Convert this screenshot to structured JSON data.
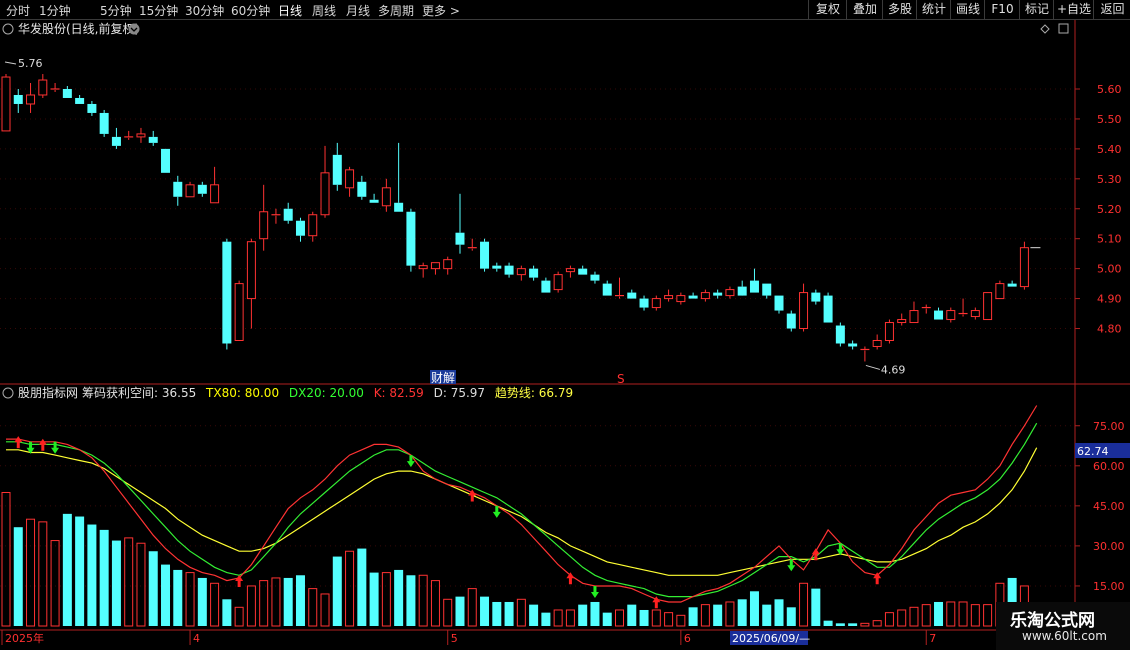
{
  "toolbar": {
    "periods": [
      {
        "label": "分时",
        "active": false
      },
      {
        "label": "1分钟",
        "active": false
      },
      {
        "label": "5分钟",
        "active": false
      },
      {
        "label": "15分钟",
        "active": false
      },
      {
        "label": "30分钟",
        "active": false
      },
      {
        "label": "60分钟",
        "active": false
      },
      {
        "label": "日线",
        "active": true
      },
      {
        "label": "周线",
        "active": false
      },
      {
        "label": "月线",
        "active": false
      },
      {
        "label": "多周期",
        "active": false
      },
      {
        "label": "更多 >",
        "active": false
      }
    ],
    "buttons": [
      "复权",
      "叠加",
      "多股",
      "统计",
      "画线",
      "F10",
      "标记",
      "+自选",
      "返回"
    ]
  },
  "main_panel": {
    "title": "华发股份(日线,前复权)",
    "high_label": "5.76",
    "low_label": "4.69",
    "event_markers": [
      "财解",
      "S"
    ],
    "yaxis_ticks": [
      "5.60",
      "5.50",
      "5.40",
      "5.30",
      "5.20",
      "5.10",
      "5.00",
      "4.90",
      "4.80"
    ]
  },
  "indicator_panel": {
    "name": "股朋指标网",
    "legend": [
      {
        "text": "筹码获利空间: 36.55",
        "color": "#e0e0e0"
      },
      {
        "text": "TX80: 80.00",
        "color": "#ffff00"
      },
      {
        "text": "DX20: 20.00",
        "color": "#33ff33"
      },
      {
        "text": "K: 82.59",
        "color": "#ff3333"
      },
      {
        "text": "D: 75.97",
        "color": "#dddddd"
      },
      {
        "text": "趋势线: 66.79",
        "color": "#ffff44"
      }
    ],
    "yaxis_ticks": [
      "75.00",
      "60.00",
      "45.00",
      "30.00",
      "15.00"
    ],
    "current_value": "62.74"
  },
  "date_axis": {
    "labels": [
      "2025年",
      "4",
      "5",
      "6",
      "7"
    ],
    "cursor_date": "2025/06/09/—"
  },
  "watermark": {
    "name": "乐淘公式网",
    "url": "www.60lt.com"
  },
  "colors": {
    "up": "#ff3232",
    "down": "#54ffff",
    "k_line": "#ff3333",
    "d_line": "#33ee33",
    "trend": "#ffff33",
    "axis": "#ff2020"
  },
  "chart_data": {
    "type": "candlestick",
    "x_axis_labels": [
      "2025年",
      "4",
      "5",
      "6",
      "7"
    ],
    "candles": [
      {
        "o": 5.46,
        "h": 5.65,
        "l": 5.46,
        "c": 5.64
      },
      {
        "o": 5.58,
        "h": 5.6,
        "l": 5.52,
        "c": 5.55
      },
      {
        "o": 5.55,
        "h": 5.62,
        "l": 5.52,
        "c": 5.58
      },
      {
        "o": 5.58,
        "h": 5.65,
        "l": 5.57,
        "c": 5.63
      },
      {
        "o": 5.6,
        "h": 5.62,
        "l": 5.59,
        "c": 5.6
      },
      {
        "o": 5.6,
        "h": 5.61,
        "l": 5.57,
        "c": 5.57
      },
      {
        "o": 5.57,
        "h": 5.58,
        "l": 5.55,
        "c": 5.55
      },
      {
        "o": 5.55,
        "h": 5.56,
        "l": 5.51,
        "c": 5.52
      },
      {
        "o": 5.52,
        "h": 5.53,
        "l": 5.44,
        "c": 5.45
      },
      {
        "o": 5.44,
        "h": 5.47,
        "l": 5.4,
        "c": 5.41
      },
      {
        "o": 5.44,
        "h": 5.46,
        "l": 5.43,
        "c": 5.44
      },
      {
        "o": 5.44,
        "h": 5.47,
        "l": 5.42,
        "c": 5.45
      },
      {
        "o": 5.44,
        "h": 5.46,
        "l": 5.41,
        "c": 5.42
      },
      {
        "o": 5.4,
        "h": 5.4,
        "l": 5.32,
        "c": 5.32
      },
      {
        "o": 5.29,
        "h": 5.31,
        "l": 5.21,
        "c": 5.24
      },
      {
        "o": 5.24,
        "h": 5.29,
        "l": 5.24,
        "c": 5.28
      },
      {
        "o": 5.28,
        "h": 5.29,
        "l": 5.24,
        "c": 5.25
      },
      {
        "o": 5.22,
        "h": 5.34,
        "l": 5.22,
        "c": 5.28
      },
      {
        "o": 5.09,
        "h": 5.1,
        "l": 4.73,
        "c": 4.75
      },
      {
        "o": 4.76,
        "h": 4.96,
        "l": 4.76,
        "c": 4.95
      },
      {
        "o": 4.9,
        "h": 5.1,
        "l": 4.8,
        "c": 5.09
      },
      {
        "o": 5.1,
        "h": 5.28,
        "l": 5.06,
        "c": 5.19
      },
      {
        "o": 5.18,
        "h": 5.2,
        "l": 5.15,
        "c": 5.18
      },
      {
        "o": 5.2,
        "h": 5.22,
        "l": 5.15,
        "c": 5.16
      },
      {
        "o": 5.16,
        "h": 5.17,
        "l": 5.09,
        "c": 5.11
      },
      {
        "o": 5.11,
        "h": 5.19,
        "l": 5.09,
        "c": 5.18
      },
      {
        "o": 5.18,
        "h": 5.41,
        "l": 5.17,
        "c": 5.32
      },
      {
        "o": 5.38,
        "h": 5.42,
        "l": 5.26,
        "c": 5.28
      },
      {
        "o": 5.27,
        "h": 5.34,
        "l": 5.24,
        "c": 5.33
      },
      {
        "o": 5.29,
        "h": 5.31,
        "l": 5.23,
        "c": 5.24
      },
      {
        "o": 5.23,
        "h": 5.25,
        "l": 5.22,
        "c": 5.22
      },
      {
        "o": 5.21,
        "h": 5.3,
        "l": 5.19,
        "c": 5.27
      },
      {
        "o": 5.22,
        "h": 5.42,
        "l": 5.19,
        "c": 5.19
      },
      {
        "o": 5.19,
        "h": 5.2,
        "l": 4.99,
        "c": 5.01
      },
      {
        "o": 5.0,
        "h": 5.02,
        "l": 4.97,
        "c": 5.01
      },
      {
        "o": 5.0,
        "h": 5.02,
        "l": 4.98,
        "c": 5.02
      },
      {
        "o": 5.0,
        "h": 5.04,
        "l": 4.98,
        "c": 5.03
      },
      {
        "o": 5.12,
        "h": 5.25,
        "l": 5.05,
        "c": 5.08
      },
      {
        "o": 5.07,
        "h": 5.1,
        "l": 5.06,
        "c": 5.07
      },
      {
        "o": 5.09,
        "h": 5.1,
        "l": 4.99,
        "c": 5.0
      },
      {
        "o": 5.01,
        "h": 5.02,
        "l": 4.99,
        "c": 5.0
      },
      {
        "o": 5.01,
        "h": 5.02,
        "l": 4.97,
        "c": 4.98
      },
      {
        "o": 4.98,
        "h": 5.01,
        "l": 4.96,
        "c": 5.0
      },
      {
        "o": 5.0,
        "h": 5.01,
        "l": 4.96,
        "c": 4.97
      },
      {
        "o": 4.96,
        "h": 4.97,
        "l": 4.92,
        "c": 4.92
      },
      {
        "o": 4.93,
        "h": 4.99,
        "l": 4.92,
        "c": 4.98
      },
      {
        "o": 4.99,
        "h": 5.01,
        "l": 4.97,
        "c": 5.0
      },
      {
        "o": 5.0,
        "h": 5.01,
        "l": 4.98,
        "c": 4.98
      },
      {
        "o": 4.98,
        "h": 4.99,
        "l": 4.95,
        "c": 4.96
      },
      {
        "o": 4.95,
        "h": 4.96,
        "l": 4.91,
        "c": 4.91
      },
      {
        "o": 4.91,
        "h": 4.97,
        "l": 4.9,
        "c": 4.91
      },
      {
        "o": 4.92,
        "h": 4.93,
        "l": 4.91,
        "c": 4.9
      },
      {
        "o": 4.9,
        "h": 4.91,
        "l": 4.86,
        "c": 4.87
      },
      {
        "o": 4.87,
        "h": 4.91,
        "l": 4.86,
        "c": 4.9
      },
      {
        "o": 4.9,
        "h": 4.93,
        "l": 4.89,
        "c": 4.91
      },
      {
        "o": 4.89,
        "h": 4.92,
        "l": 4.88,
        "c": 4.91
      },
      {
        "o": 4.91,
        "h": 4.92,
        "l": 4.9,
        "c": 4.9
      },
      {
        "o": 4.9,
        "h": 4.93,
        "l": 4.89,
        "c": 4.92
      },
      {
        "o": 4.92,
        "h": 4.93,
        "l": 4.9,
        "c": 4.91
      },
      {
        "o": 4.91,
        "h": 4.94,
        "l": 4.9,
        "c": 4.93
      },
      {
        "o": 4.94,
        "h": 4.96,
        "l": 4.92,
        "c": 4.91
      },
      {
        "o": 4.96,
        "h": 5.0,
        "l": 4.92,
        "c": 4.92
      },
      {
        "o": 4.95,
        "h": 4.95,
        "l": 4.9,
        "c": 4.91
      },
      {
        "o": 4.91,
        "h": 4.91,
        "l": 4.85,
        "c": 4.86
      },
      {
        "o": 4.85,
        "h": 4.86,
        "l": 4.79,
        "c": 4.8
      },
      {
        "o": 4.8,
        "h": 4.95,
        "l": 4.79,
        "c": 4.92
      },
      {
        "o": 4.92,
        "h": 4.93,
        "l": 4.88,
        "c": 4.89
      },
      {
        "o": 4.91,
        "h": 4.92,
        "l": 4.82,
        "c": 4.82
      },
      {
        "o": 4.81,
        "h": 4.82,
        "l": 4.74,
        "c": 4.75
      },
      {
        "o": 4.75,
        "h": 4.76,
        "l": 4.73,
        "c": 4.74
      },
      {
        "o": 4.73,
        "h": 4.74,
        "l": 4.69,
        "c": 4.73
      },
      {
        "o": 4.74,
        "h": 4.78,
        "l": 4.73,
        "c": 4.76
      },
      {
        "o": 4.76,
        "h": 4.83,
        "l": 4.75,
        "c": 4.82
      },
      {
        "o": 4.82,
        "h": 4.85,
        "l": 4.81,
        "c": 4.83
      },
      {
        "o": 4.82,
        "h": 4.89,
        "l": 4.82,
        "c": 4.86
      },
      {
        "o": 4.87,
        "h": 4.88,
        "l": 4.85,
        "c": 4.87
      },
      {
        "o": 4.86,
        "h": 4.87,
        "l": 4.83,
        "c": 4.83
      },
      {
        "o": 4.83,
        "h": 4.87,
        "l": 4.82,
        "c": 4.86
      },
      {
        "o": 4.85,
        "h": 4.9,
        "l": 4.84,
        "c": 4.85
      },
      {
        "o": 4.84,
        "h": 4.87,
        "l": 4.83,
        "c": 4.86
      },
      {
        "o": 4.83,
        "h": 4.92,
        "l": 4.83,
        "c": 4.92
      },
      {
        "o": 4.9,
        "h": 4.96,
        "l": 4.9,
        "c": 4.95
      },
      {
        "o": 4.95,
        "h": 4.96,
        "l": 4.94,
        "c": 4.94
      },
      {
        "o": 4.94,
        "h": 5.09,
        "l": 4.93,
        "c": 5.07
      }
    ],
    "volume": [
      50,
      37,
      40,
      39,
      32,
      42,
      41,
      38,
      36,
      32,
      33,
      31,
      28,
      23,
      21,
      20,
      18,
      16,
      10,
      7,
      15,
      17,
      18,
      18,
      19,
      14,
      12,
      26,
      28,
      29,
      20,
      20,
      21,
      19,
      19,
      17,
      10,
      11,
      14,
      11,
      9,
      9,
      10,
      8,
      5,
      6,
      6,
      8,
      9,
      5,
      6,
      8,
      6,
      6,
      5,
      4,
      7,
      8,
      8,
      9,
      10,
      13,
      8,
      10,
      7,
      16,
      14,
      2,
      1,
      1,
      1,
      2,
      5,
      6,
      7,
      8,
      9,
      9,
      9,
      8,
      8,
      16,
      18,
      15,
      23,
      23
    ],
    "k": [
      70,
      70,
      69,
      69,
      69,
      68,
      66,
      63,
      58,
      52,
      46,
      40,
      34,
      29,
      25,
      22,
      20,
      19,
      17,
      18,
      23,
      30,
      37,
      44,
      48,
      51,
      55,
      60,
      64,
      66,
      68,
      68,
      67,
      64,
      58,
      55,
      53,
      52,
      50,
      48,
      45,
      42,
      38,
      33,
      28,
      23,
      19,
      16,
      15,
      15,
      15,
      14,
      12,
      10,
      9,
      9,
      11,
      13,
      14,
      16,
      19,
      22,
      26,
      30,
      25,
      21,
      28,
      36,
      31,
      24,
      20,
      19,
      23,
      29,
      36,
      41,
      46,
      49,
      50,
      51,
      55,
      60,
      68,
      75,
      82.59
    ],
    "d": [
      69,
      69,
      68,
      68,
      68,
      67,
      66,
      64,
      61,
      57,
      52,
      47,
      42,
      37,
      32,
      28,
      25,
      22,
      20,
      19,
      21,
      26,
      31,
      37,
      42,
      46,
      50,
      54,
      58,
      61,
      64,
      66,
      66,
      64,
      61,
      58,
      56,
      54,
      52,
      50,
      48,
      45,
      42,
      38,
      34,
      30,
      26,
      22,
      19,
      17,
      16,
      15,
      14,
      12,
      11,
      11,
      11,
      12,
      13,
      15,
      17,
      20,
      23,
      26,
      26,
      24,
      26,
      30,
      31,
      28,
      25,
      22,
      22,
      26,
      31,
      36,
      40,
      43,
      46,
      48,
      51,
      55,
      61,
      68,
      75.97
    ],
    "trend": [
      66,
      66,
      65,
      65,
      64,
      63,
      62,
      61,
      59,
      56,
      53,
      50,
      47,
      44,
      40,
      37,
      34,
      32,
      30,
      28,
      28,
      29,
      31,
      34,
      37,
      40,
      43,
      46,
      49,
      52,
      55,
      57,
      58,
      58,
      57,
      55,
      53,
      51,
      49,
      47,
      45,
      43,
      41,
      38,
      35,
      33,
      30,
      28,
      26,
      24,
      23,
      22,
      21,
      20,
      19,
      19,
      19,
      19,
      19,
      20,
      21,
      22,
      23,
      24,
      25,
      25,
      25,
      26,
      27,
      26,
      25,
      24,
      24,
      25,
      27,
      29,
      32,
      34,
      37,
      39,
      42,
      46,
      51,
      58,
      66.79
    ],
    "up_arrows": [
      1,
      3,
      19,
      38,
      46,
      53,
      66,
      71
    ],
    "down_arrows": [
      2,
      4,
      33,
      40,
      48,
      64,
      68
    ]
  }
}
